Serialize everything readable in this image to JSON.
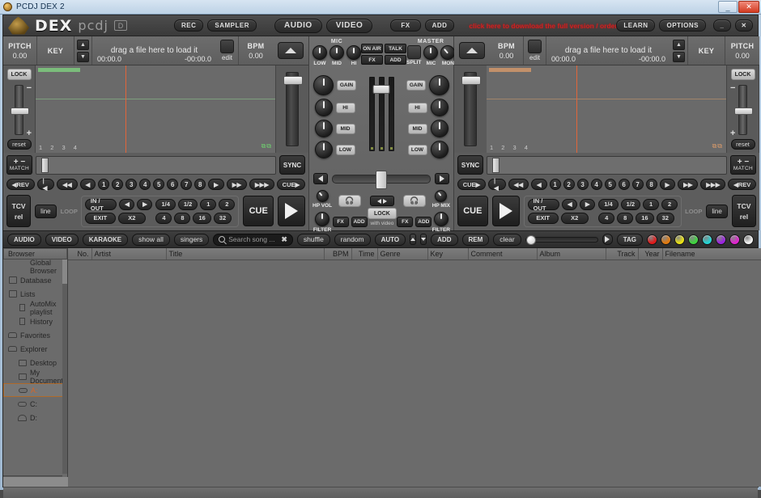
{
  "window": {
    "title": "PCDJ DEX 2",
    "minimize": "_",
    "close": "✕"
  },
  "toolbar": {
    "logo_dex": "DEX",
    "logo_pcdj": "pcdj",
    "logo_d": "D",
    "rec": "REC",
    "sampler": "SAMPLER",
    "audio": "AUDIO",
    "video": "VIDEO",
    "fx": "FX",
    "add": "ADD",
    "promo": "click here to download the full version / order online",
    "learn": "LEARN",
    "options": "OPTIONS"
  },
  "deck_left": {
    "pitch_label": "PITCH",
    "pitch_value": "0.00",
    "key_label": "KEY",
    "drag_text": "drag a file here to load it",
    "elapsed": "00:00.0",
    "remaining": "-00:00.0",
    "edit": "edit",
    "bpm_label": "BPM",
    "bpm_value": "0.00",
    "lock": "LOCK",
    "reset": "reset",
    "plus": "+",
    "minus": "−",
    "beatnums": "1 2 3 4",
    "match_plus": "+",
    "match_minus": "−",
    "match": "MATCH",
    "sync": "SYNC",
    "rev": "◀REV",
    "cue_arrow": "CUE▶",
    "cue_points": [
      "1",
      "2",
      "3",
      "4",
      "5",
      "6",
      "7",
      "8"
    ],
    "tcv": "TCV",
    "rel": "rel",
    "line": "line",
    "loop_label": "LOOP",
    "in_out": "IN / OUT",
    "exit": "EXIT",
    "x2": "X2",
    "loop_sizes_top": [
      "1/4",
      "1/2",
      "1",
      "2"
    ],
    "loop_sizes_bot": [
      "4",
      "8",
      "16",
      "32"
    ],
    "cue_big": "CUE"
  },
  "deck_right": {
    "pitch_label": "PITCH",
    "pitch_value": "0.00",
    "key_label": "KEY",
    "drag_text": "drag a file here to load it",
    "elapsed": "00:00.0",
    "remaining": "-00:00.0",
    "edit": "edit",
    "bpm_label": "BPM",
    "bpm_value": "0.00",
    "lock": "LOCK",
    "reset": "reset",
    "plus": "+",
    "minus": "−",
    "beatnums": "1 2 3 4",
    "match_plus": "+",
    "match_minus": "−",
    "match": "MATCH",
    "sync": "SYNC",
    "rev": "◀REV",
    "cue_arrow": "CUE▶",
    "cue_points": [
      "1",
      "2",
      "3",
      "4",
      "5",
      "6",
      "7",
      "8"
    ],
    "tcv": "TCV",
    "rel": "rel",
    "line": "line",
    "loop_label": "LOOP",
    "in_out": "IN / OUT",
    "exit": "EXIT",
    "x2": "X2",
    "loop_sizes_top": [
      "1/4",
      "1/2",
      "1",
      "2"
    ],
    "loop_sizes_bot": [
      "4",
      "8",
      "16",
      "32"
    ],
    "cue_big": "CUE"
  },
  "mixer": {
    "mic_header": "MIC",
    "mic_knobs": [
      "LOW",
      "MID",
      "HI"
    ],
    "on_air": "ON AIR",
    "talk": "TALK",
    "fx": "FX",
    "add": "ADD",
    "master_header": "MASTER",
    "split": "SPLIT",
    "master_mic": "MIC",
    "mon": "MON",
    "gain": "GAIN",
    "eq": [
      "HI",
      "MID",
      "LOW"
    ],
    "hp_vol": "HP VOL",
    "hp_mix": "HP MIX",
    "filter": "FILTER",
    "lock": "LOCK",
    "with_video": "with video",
    "fx_btn": "FX",
    "add_btn": "ADD"
  },
  "browser_toolbar": {
    "audio": "AUDIO",
    "video": "VIDEO",
    "karaoke": "KARAOKE",
    "show_all": "show all",
    "singers": "singers",
    "search_placeholder": "Search song ...",
    "search_clear": "✖",
    "shuffle": "shuffle",
    "random": "random",
    "auto": "AUTO",
    "add": "ADD",
    "rem": "REM",
    "clear": "clear",
    "tag": "TAG",
    "tag_colors": [
      "#e01b1b",
      "#e07a10",
      "#e8e015",
      "#3fd43f",
      "#24d4d4",
      "#9b24e0",
      "#e024d0",
      "#f2f2f2"
    ]
  },
  "tree": {
    "header": "Browser",
    "items": [
      {
        "label": "Global Browser",
        "icon": "none",
        "indent": 1
      },
      {
        "label": "Database",
        "icon": "database-icon",
        "indent": 0
      },
      {
        "label": "Lists",
        "icon": "lists-icon",
        "indent": 0
      },
      {
        "label": "AutoMix playlist",
        "icon": "playlist-icon",
        "indent": 1
      },
      {
        "label": "History",
        "icon": "playlist-icon",
        "indent": 1
      },
      {
        "label": "Favorites",
        "icon": "favorites-icon",
        "indent": 0
      },
      {
        "label": "Explorer",
        "icon": "explorer-icon",
        "indent": 0
      },
      {
        "label": "Desktop",
        "icon": "folder-icon",
        "indent": 1
      },
      {
        "label": "My Documents",
        "icon": "folder-icon",
        "indent": 1
      },
      {
        "label": "A:",
        "icon": "floppy-drive-icon",
        "indent": 1,
        "selected": true
      },
      {
        "label": "C:",
        "icon": "floppy-drive-icon",
        "indent": 1
      },
      {
        "label": "D:",
        "icon": "disc-drive-icon",
        "indent": 1
      }
    ]
  },
  "grid": {
    "columns": [
      {
        "label": "No.",
        "width": 30,
        "align": "right"
      },
      {
        "label": "Artist",
        "width": 92,
        "align": "left"
      },
      {
        "label": "Title",
        "width": 195,
        "align": "left"
      },
      {
        "label": "BPM",
        "width": 34,
        "align": "right"
      },
      {
        "label": "Time",
        "width": 32,
        "align": "right"
      },
      {
        "label": "Genre",
        "width": 62,
        "align": "left"
      },
      {
        "label": "Key",
        "width": 50,
        "align": "left"
      },
      {
        "label": "Comment",
        "width": 85,
        "align": "left"
      },
      {
        "label": "Album",
        "width": 85,
        "align": "left"
      },
      {
        "label": "Track",
        "width": 40,
        "align": "right"
      },
      {
        "label": "Year",
        "width": 30,
        "align": "right"
      },
      {
        "label": "Filename",
        "width": 140,
        "align": "left"
      }
    ],
    "rows": []
  }
}
